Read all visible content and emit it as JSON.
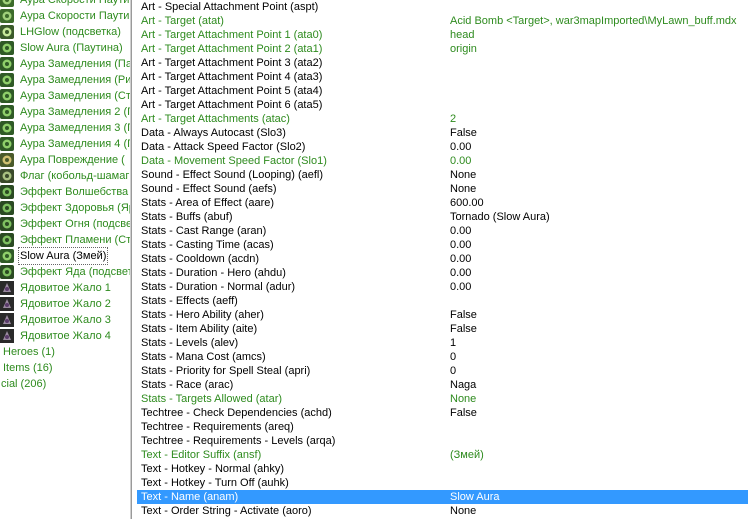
{
  "tree": {
    "items": [
      {
        "label": "Аура Скорости Паути",
        "color": "green",
        "icon": "web-aura-icon"
      },
      {
        "label": "Аура Скорости Паути",
        "color": "green",
        "icon": "web-aura-icon"
      },
      {
        "label": "LHGlow (подсветка)",
        "color": "green",
        "icon": "glow-aura-icon"
      },
      {
        "label": "Slow Aura (Паутина)",
        "color": "green",
        "icon": "slow-aura-icon"
      },
      {
        "label": "Аура Замедления (Па",
        "color": "green",
        "icon": "slow-aura-icon"
      },
      {
        "label": "Аура Замедления (Ри",
        "color": "green",
        "icon": "slow-aura-icon"
      },
      {
        "label": "Аура Замедления (Ст",
        "color": "green",
        "icon": "slow-aura-icon"
      },
      {
        "label": "Аура Замедления 2 (Г",
        "color": "green",
        "icon": "slow-aura-icon"
      },
      {
        "label": "Аура Замедления 3 (Г",
        "color": "green",
        "icon": "slow-aura-icon"
      },
      {
        "label": "Аура Замедления 4 (Г",
        "color": "green",
        "icon": "slow-aura-icon"
      },
      {
        "label": "Аура Повреждение (",
        "color": "green",
        "icon": "damage-aura-icon"
      },
      {
        "label": "Флаг (кобольд-шамаг",
        "color": "green",
        "icon": "flag-aura-icon"
      },
      {
        "label": "Эффект Волшебства",
        "color": "green",
        "icon": "effect-icon"
      },
      {
        "label": "Эффект Здоровья (Яр",
        "color": "green",
        "icon": "effect-icon"
      },
      {
        "label": "Эффект Огня (подсве",
        "color": "green",
        "icon": "effect-icon"
      },
      {
        "label": "Эффект Пламени (Стр",
        "color": "green",
        "icon": "effect-icon"
      },
      {
        "label": "Slow Aura (Змей)",
        "color": "black",
        "icon": "slow-aura-icon",
        "selected": true
      },
      {
        "label": "Эффект Яда (подсвет",
        "color": "green",
        "icon": "effect-icon"
      },
      {
        "label": "Ядовитое Жало 1",
        "color": "green",
        "icon": "poison-sting-icon"
      },
      {
        "label": "Ядовитое Жало 2",
        "color": "green",
        "icon": "poison-sting-icon"
      },
      {
        "label": "Ядовитое Жало 3",
        "color": "green",
        "icon": "poison-sting-icon"
      },
      {
        "label": "Ядовитое Жало 4",
        "color": "green",
        "icon": "poison-sting-icon"
      }
    ],
    "categories": [
      {
        "label": "Heroes (1)"
      },
      {
        "label": "Items (16)"
      },
      {
        "label": "cial (206)"
      }
    ]
  },
  "properties": [
    {
      "name": "Art - Special Attachment Point (aspt)",
      "value": "",
      "color": "black"
    },
    {
      "name": "Art - Target (atat)",
      "value": "Acid Bomb <Target>, war3mapImported\\MyLawn_buff.mdx",
      "color": "green"
    },
    {
      "name": "Art - Target Attachment Point 1 (ata0)",
      "value": "head",
      "color": "green"
    },
    {
      "name": "Art - Target Attachment Point 2 (ata1)",
      "value": "origin",
      "color": "green"
    },
    {
      "name": "Art - Target Attachment Point 3 (ata2)",
      "value": "",
      "color": "black"
    },
    {
      "name": "Art - Target Attachment Point 4 (ata3)",
      "value": "",
      "color": "black"
    },
    {
      "name": "Art - Target Attachment Point 5 (ata4)",
      "value": "",
      "color": "black"
    },
    {
      "name": "Art - Target Attachment Point 6 (ata5)",
      "value": "",
      "color": "black"
    },
    {
      "name": "Art - Target Attachments (atac)",
      "value": "2",
      "color": "green"
    },
    {
      "name": "Data - Always Autocast (Slo3)",
      "value": "False",
      "color": "black"
    },
    {
      "name": "Data - Attack Speed Factor (Slo2)",
      "value": "0.00",
      "color": "black"
    },
    {
      "name": "Data - Movement Speed Factor (Slo1)",
      "value": "0.00",
      "color": "green"
    },
    {
      "name": "Sound - Effect Sound (Looping) (aefl)",
      "value": "None",
      "color": "black"
    },
    {
      "name": "Sound - Effect Sound (aefs)",
      "value": "None",
      "color": "black"
    },
    {
      "name": "Stats - Area of Effect (aare)",
      "value": "600.00",
      "color": "black"
    },
    {
      "name": "Stats - Buffs (abuf)",
      "value": "Tornado (Slow Aura)",
      "color": "black"
    },
    {
      "name": "Stats - Cast Range (aran)",
      "value": "0.00",
      "color": "black"
    },
    {
      "name": "Stats - Casting Time (acas)",
      "value": "0.00",
      "color": "black"
    },
    {
      "name": "Stats - Cooldown (acdn)",
      "value": "0.00",
      "color": "black"
    },
    {
      "name": "Stats - Duration - Hero (ahdu)",
      "value": "0.00",
      "color": "black"
    },
    {
      "name": "Stats - Duration - Normal (adur)",
      "value": "0.00",
      "color": "black"
    },
    {
      "name": "Stats - Effects (aeff)",
      "value": "",
      "color": "black"
    },
    {
      "name": "Stats - Hero Ability (aher)",
      "value": "False",
      "color": "black"
    },
    {
      "name": "Stats - Item Ability (aite)",
      "value": "False",
      "color": "black"
    },
    {
      "name": "Stats - Levels (alev)",
      "value": "1",
      "color": "black"
    },
    {
      "name": "Stats - Mana Cost (amcs)",
      "value": "0",
      "color": "black"
    },
    {
      "name": "Stats - Priority for Spell Steal (apri)",
      "value": "0",
      "color": "black"
    },
    {
      "name": "Stats - Race (arac)",
      "value": "Naga",
      "color": "black"
    },
    {
      "name": "Stats - Targets Allowed (atar)",
      "value": "None",
      "color": "green"
    },
    {
      "name": "Techtree - Check Dependencies (achd)",
      "value": "False",
      "color": "black"
    },
    {
      "name": "Techtree - Requirements (areq)",
      "value": "",
      "color": "black"
    },
    {
      "name": "Techtree - Requirements - Levels (arqa)",
      "value": "",
      "color": "black"
    },
    {
      "name": "Text - Editor Suffix (ansf)",
      "value": " (Змей)",
      "color": "green"
    },
    {
      "name": "Text - Hotkey - Normal (ahky)",
      "value": "",
      "color": "black"
    },
    {
      "name": "Text - Hotkey - Turn Off (auhk)",
      "value": "",
      "color": "black"
    },
    {
      "name": "Text - Name (anam)",
      "value": "Slow Aura",
      "color": "black",
      "selected": true
    },
    {
      "name": "Text - Order String - Activate (aoro)",
      "value": "None",
      "color": "black"
    }
  ],
  "colors": {
    "modified": "#2e8b1e",
    "selection": "#3399ff"
  }
}
